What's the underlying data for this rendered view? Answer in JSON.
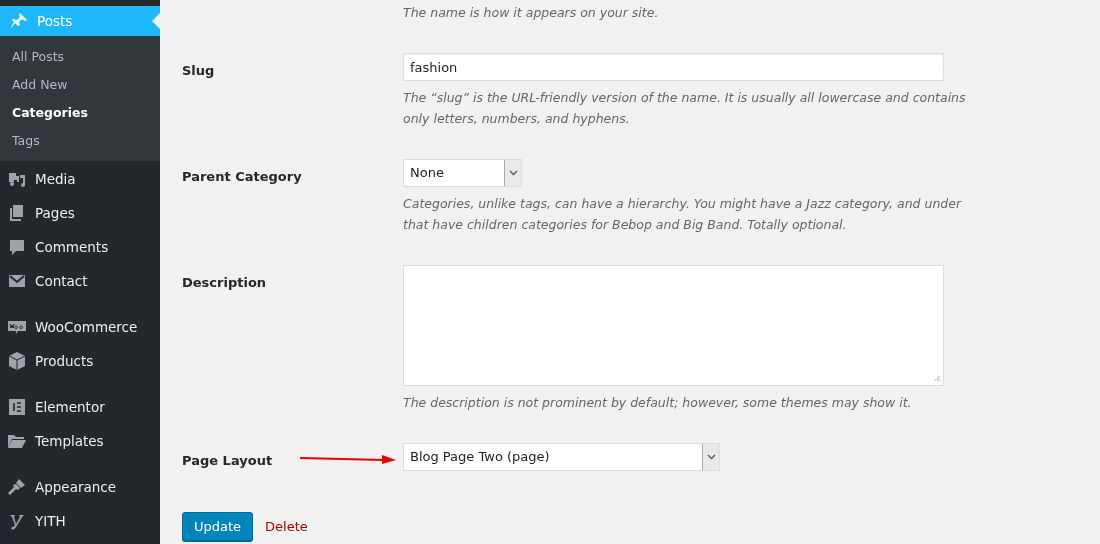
{
  "sidebar": {
    "current": {
      "label": "Posts",
      "selected": true
    },
    "submenu": [
      {
        "label": "All Posts",
        "selected": false
      },
      {
        "label": "Add New",
        "selected": false
      },
      {
        "label": "Categories",
        "selected": true
      },
      {
        "label": "Tags",
        "selected": false
      }
    ],
    "menu_groups": [
      [
        {
          "label": "Media"
        },
        {
          "label": "Pages"
        },
        {
          "label": "Comments"
        },
        {
          "label": "Contact"
        }
      ],
      [
        {
          "label": "WooCommerce"
        },
        {
          "label": "Products"
        }
      ],
      [
        {
          "label": "Elementor"
        },
        {
          "label": "Templates"
        }
      ],
      [
        {
          "label": "Appearance"
        },
        {
          "label": "YITH"
        }
      ]
    ]
  },
  "intro_help": "The name is how it appears on your site.",
  "fields": [
    {
      "kind": "text",
      "label": "Slug",
      "value": "fashion",
      "help": [
        "The “slug” is the URL-friendly version of the name. It is usually all lowercase and contains",
        "only letters, numbers, and hyphens."
      ]
    },
    {
      "kind": "select",
      "label": "Parent Category",
      "value": "None",
      "help": [
        "Categories, unlike tags, can have a hierarchy. You might have a Jazz category, and under",
        "that have children categories for Bebop and Big Band. Totally optional."
      ]
    },
    {
      "kind": "textarea",
      "label": "Description",
      "help": [
        "The description is not prominent by default; however, some themes may show it."
      ]
    },
    {
      "kind": "select",
      "label": "Page Layout",
      "value": "Blog Page Two (page)",
      "pointer": true
    }
  ],
  "actions": {
    "update": "Update",
    "delete": "Delete"
  }
}
